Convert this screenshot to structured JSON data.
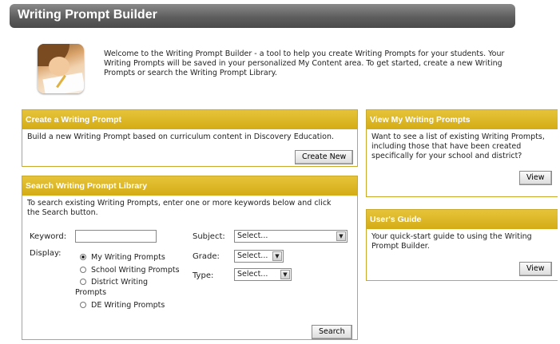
{
  "header": {
    "title": "Writing Prompt Builder"
  },
  "welcome": {
    "text": "Welcome to the Writing Prompt Builder - a tool to help you create Writing Prompts for your students. Your Writing Prompts will be saved in your personalized My Content area. To get started, create a new Writing Prompts or search the Writing Prompt Library."
  },
  "create": {
    "title": "Create a Writing Prompt",
    "description": "Build a new Writing Prompt based on curriculum content in Discovery Education.",
    "button": "Create New"
  },
  "search": {
    "title": "Search Writing Prompt Library",
    "description": "To search existing Writing Prompts, enter one or more keywords below and click the Search button.",
    "keyword_label": "Keyword:",
    "keyword_value": "",
    "display_label": "Display:",
    "display_options": [
      "My Writing Prompts",
      "School Writing Prompts",
      "District Writing",
      "Prompts",
      "DE Writing Prompts"
    ],
    "selected_display": "My Writing Prompts",
    "subject_label": "Subject:",
    "subject_value": "Select...",
    "grade_label": "Grade:",
    "grade_value": "Select...",
    "type_label": "Type:",
    "type_value": "Select...",
    "button": "Search"
  },
  "view_prompts": {
    "title": "View My Writing Prompts",
    "description": "Want to see a list of existing Writing Prompts, including those that have been created specifically for your school and district?",
    "button": "View"
  },
  "guide": {
    "title": "User's Guide",
    "description": "Your quick-start guide to using the Writing Prompt Builder.",
    "button": "View"
  },
  "colors": {
    "accent": "#d4ac15",
    "header_bar": "#5e5e5e"
  }
}
